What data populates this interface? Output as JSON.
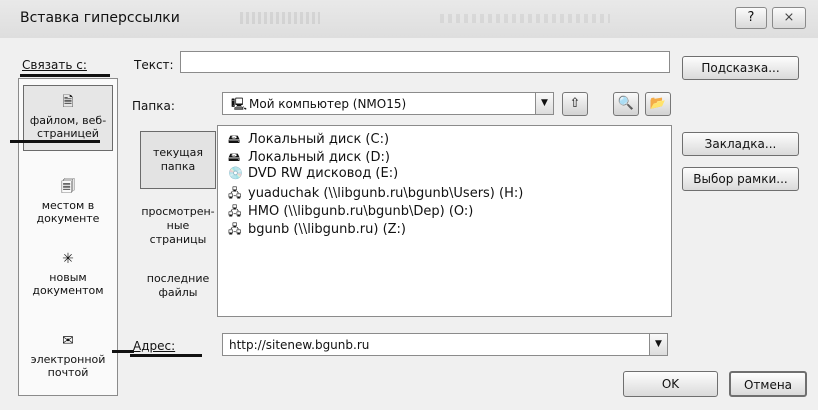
{
  "window": {
    "title": "Вставка гиперссылки",
    "help_glyph": "?",
    "close_glyph": "⨯"
  },
  "link_to": {
    "label": "Связать с:",
    "items": [
      {
        "label": "файлом, веб-страницей",
        "icon": "document-web-icon"
      },
      {
        "label": "местом в документе",
        "icon": "document-place-icon"
      },
      {
        "label": "новым документом",
        "icon": "new-document-icon"
      },
      {
        "label": "электронной почтой",
        "icon": "email-icon"
      }
    ]
  },
  "text_field": {
    "label": "Текст:",
    "value": ""
  },
  "folder": {
    "label": "Папка:",
    "value": "Мой компьютер (NMO15)"
  },
  "browse_tabs": {
    "current": "текущая папка",
    "browsed": "просмотрен-ные страницы",
    "recent": "последние файлы"
  },
  "files": [
    {
      "name": "Локальный диск (C:)",
      "icon": "local-disk-icon"
    },
    {
      "name": "Локальный диск (D:)",
      "icon": "local-disk-icon"
    },
    {
      "name": "DVD RW дисковод (E:)",
      "icon": "dvd-drive-icon"
    },
    {
      "name": "yuaduchak (\\\\libgunb.ru\\bgunb\\Users) (H:)",
      "icon": "network-drive-icon"
    },
    {
      "name": "HMO (\\\\libgunb.ru\\bgunb\\Dep) (O:)",
      "icon": "network-drive-icon"
    },
    {
      "name": "bgunb (\\\\libgunb.ru) (Z:)",
      "icon": "network-drive-icon"
    }
  ],
  "address": {
    "label": "Адрес:",
    "value": "http://sitenew.bgunb.ru"
  },
  "buttons": {
    "hint": "Подсказка...",
    "bookmark": "Закладка...",
    "frame": "Выбор рамки...",
    "ok": "OK",
    "cancel": "Отмена"
  }
}
